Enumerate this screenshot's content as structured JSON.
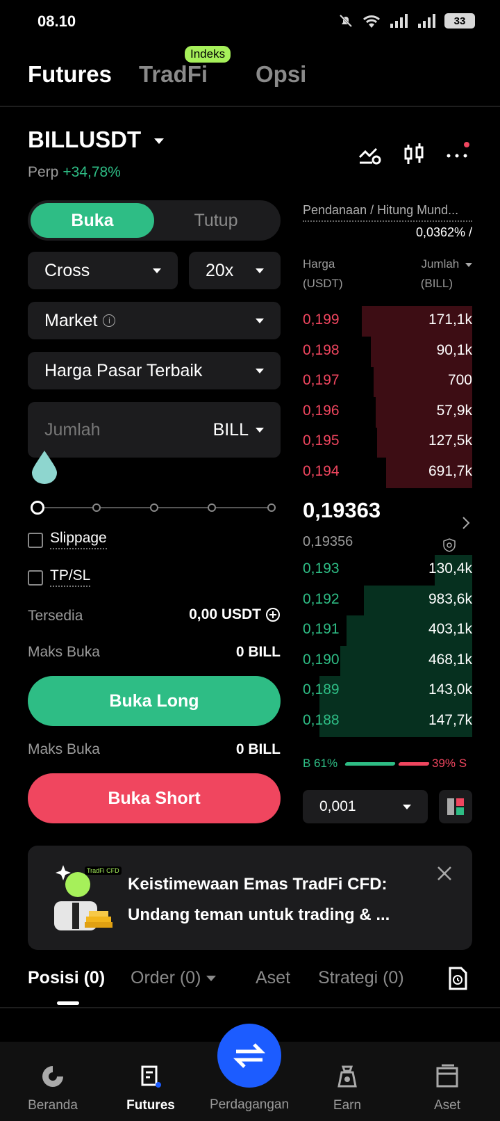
{
  "status": {
    "time": "08.10",
    "battery": "33"
  },
  "top_tabs": {
    "futures": "Futures",
    "tradfi": "TradFi",
    "opsi": "Opsi",
    "badge": "Indeks"
  },
  "pair": {
    "symbol": "BILLUSDT",
    "type": "Perp",
    "change": "+34,78%"
  },
  "form": {
    "open_label": "Buka",
    "close_label": "Tutup",
    "margin_mode": "Cross",
    "leverage": "20x",
    "order_type": "Market",
    "price_mode": "Harga Pasar Terbaik",
    "amount_placeholder": "Jumlah",
    "amount_unit": "BILL",
    "slippage_label": "Slippage",
    "tpsl_label": "TP/SL",
    "available_label": "Tersedia",
    "available_value": "0,00 USDT",
    "max_open_label": "Maks Buka",
    "max_open_long": "0 BILL",
    "max_open_short": "0 BILL",
    "long_button": "Buka Long",
    "short_button": "Buka Short"
  },
  "orderbook": {
    "funding_label": "Pendanaan / Hitung Mund...",
    "funding_value": "0,0362% /",
    "price_header_1": "Harga",
    "price_header_2": "(USDT)",
    "qty_header_1": "Jumlah",
    "qty_header_2": "(BILL)",
    "asks": [
      {
        "price": "0,199",
        "qty": "171,1k",
        "depth": 0.65
      },
      {
        "price": "0,198",
        "qty": "90,1k",
        "depth": 0.6
      },
      {
        "price": "0,197",
        "qty": "700",
        "depth": 0.58
      },
      {
        "price": "0,196",
        "qty": "57,9k",
        "depth": 0.57
      },
      {
        "price": "0,195",
        "qty": "127,5k",
        "depth": 0.56
      },
      {
        "price": "0,194",
        "qty": "691,7k",
        "depth": 0.51
      }
    ],
    "last_price": "0,19363",
    "mark_price": "0,19356",
    "bids": [
      {
        "price": "0,193",
        "qty": "130,4k",
        "depth": 0.22
      },
      {
        "price": "0,192",
        "qty": "983,6k",
        "depth": 0.64
      },
      {
        "price": "0,191",
        "qty": "403,1k",
        "depth": 0.74
      },
      {
        "price": "0,190",
        "qty": "468,1k",
        "depth": 0.78
      },
      {
        "price": "0,189",
        "qty": "143,0k",
        "depth": 0.9
      },
      {
        "price": "0,188",
        "qty": "147,7k",
        "depth": 0.9
      }
    ],
    "buy_ratio": "B 61%",
    "sell_ratio": "39% S",
    "tick_size": "0,001"
  },
  "promo": {
    "line1": "Keistimewaan Emas TradFi CFD:",
    "line2": "Undang teman untuk trading & ...",
    "badge": "TradFi CFD"
  },
  "bottom_tabs": {
    "positions": "Posisi (0)",
    "orders": "Order (0)",
    "assets": "Aset",
    "strategies": "Strategi (0)"
  },
  "nav": {
    "home": "Beranda",
    "futures": "Futures",
    "trade": "Perdagangan",
    "earn": "Earn",
    "assets": "Aset"
  },
  "colors": {
    "buy": "#2ebd85",
    "sell": "#f0465f",
    "accent": "#1c5cff",
    "badge": "#a6f05a"
  }
}
